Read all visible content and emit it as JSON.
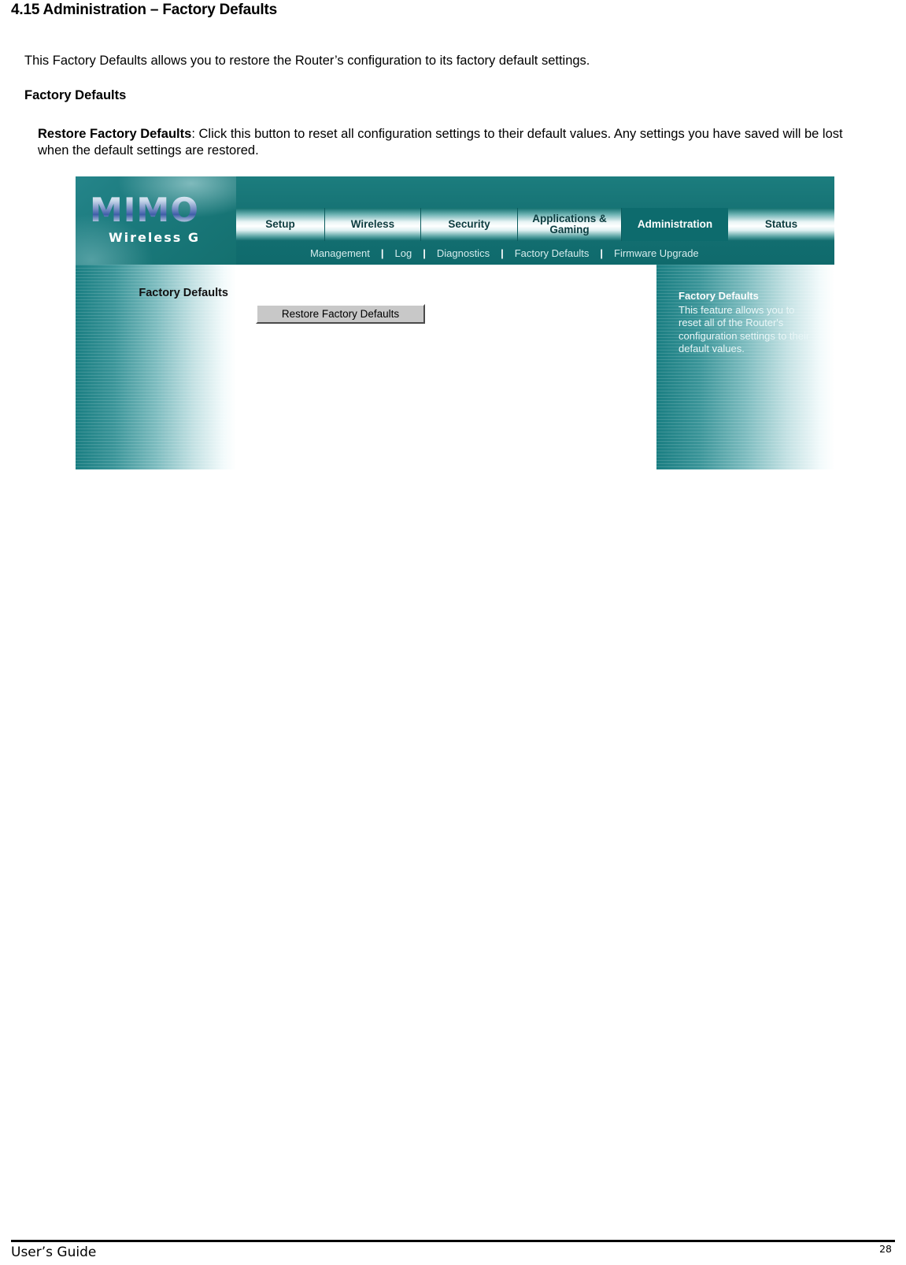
{
  "document": {
    "heading": "4.15 Administration – Factory Defaults",
    "intro_paragraph": "This Factory Defaults allows you to restore the Router’s configuration to its factory default settings.",
    "subheading": "Factory Defaults",
    "body_label": "Restore Factory Defaults",
    "body_text": ": Click this button to reset all configuration settings to their default values. Any settings you have saved will be lost when the default settings are restored."
  },
  "screenshot": {
    "logo": {
      "brand": "MIMO",
      "tagline": "Wireless G"
    },
    "tabs": [
      {
        "label": "Setup",
        "active": false
      },
      {
        "label": "Wireless",
        "active": false
      },
      {
        "label": "Security",
        "active": false
      },
      {
        "label": "Applications & Gaming",
        "line1": "Applications &",
        "line2": "Gaming",
        "active": false
      },
      {
        "label": "Administration",
        "active": true
      },
      {
        "label": "Status",
        "active": false
      }
    ],
    "subnav": [
      {
        "label": "Management"
      },
      {
        "label": "Log"
      },
      {
        "label": "Diagnostics"
      },
      {
        "label": "Factory Defaults"
      },
      {
        "label": "Firmware Upgrade"
      }
    ],
    "subnav_separator": "|",
    "section_title": "Factory Defaults",
    "restore_button_label": "Restore Factory Defaults",
    "help": {
      "title": "Factory Defaults",
      "text": "This feature allows you to reset all of the Router's configuration settings to their default values."
    },
    "colors": {
      "teal_dark": "#0d6b6d",
      "teal": "#1a7e82",
      "teal_light": "#7dbcbf",
      "button_face": "#c8c8c8"
    }
  },
  "footer": {
    "left_label": "User’s Guide",
    "page_number": "28"
  }
}
